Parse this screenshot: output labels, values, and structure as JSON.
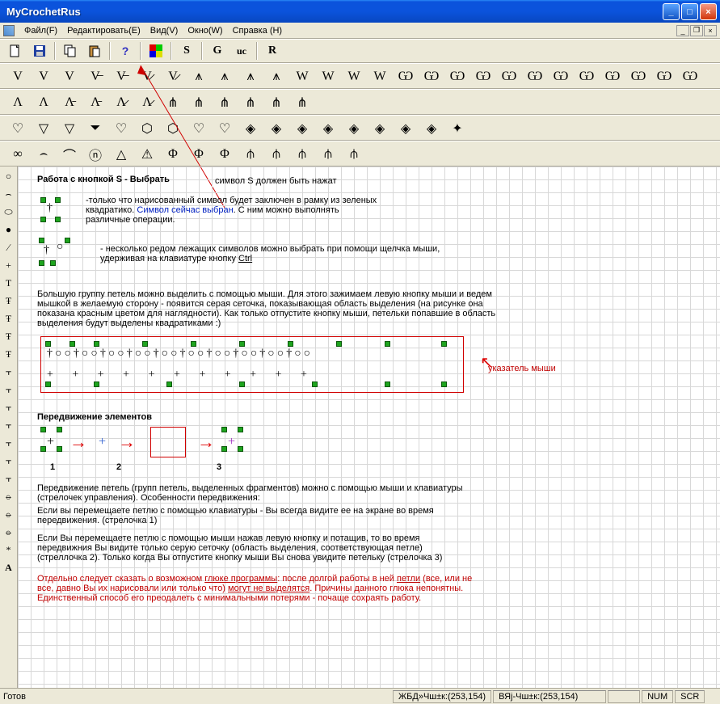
{
  "window": {
    "title": "MyCrochetRus"
  },
  "menu": {
    "file": "Файл(F)",
    "edit": "Редактировать(E)",
    "view": "Вид(V)",
    "window": "Окно(W)",
    "help": "Справка (H)"
  },
  "toolbar1": {
    "letters": [
      "S",
      "G",
      "uc",
      "R"
    ]
  },
  "doc": {
    "heading1": "Работа с кнопкой S - Выбрать",
    "callout1": "символ S должен быть нажат",
    "para1a": "-только что нарисованный символ будет заключен в рамку из зеленых квадратико. ",
    "para1b": "Символ сейчас выбран",
    "para1c": ". С ним можно выполнять различные операции.",
    "para2a": "- несколько редом лежащих символов можно выбрать при помощи щелчка мыши, удерживая на клавиатуре кнопку ",
    "para2b": "Ctrl",
    "para3": "Большую группу петель можно выделить с помощью мыши. Для этого зажимаем левую кнопку мыши и ведем мышкой в желаемую сторону - появится серая сеточка, показывающая область выделения (на рисунке она показана красным цветом для наглядности). Как только отпустите кнопку мыши, петельки попавшие в область выделения будут выделены квадратиками :)",
    "pointer_label": "указатель мыши",
    "heading2": "Передвижение элементов",
    "step1": "1",
    "step2": "2",
    "step3": "3",
    "para4": "Передвижение петель (групп петель, выделенных фрагментов) можно с помощью мыши и клавиатуры (стрелочек управления). Особенности передвижения:",
    "para5": "Если вы перемещаете петлю с помощью клавиатуры - Вы всегда видите ее на экране во время передвижения. (стрелочка 1)",
    "para6": "Если Вы перемещаете петлю с помощью мыши нажав левую кнопку и потащив, то во время передвижния Вы видите только серую сеточку (область выделения, соответствующая петле) (стреллочка 2). Только когда Вы отпустите кнопку мыши Вы снова увидите петельку (стрелочка 3)",
    "para7a": "Отдельно следует сказать о возможном ",
    "para7b": "глюке программы",
    "para7c": ": после долгой работы в ней ",
    "para7d": "петли",
    "para7e": " (все, или не все, давно Вы их нарисовали или только что) ",
    "para7f": "могут не выделятся",
    "para7g": ". Причины данного глюка непонятны. Единственный способ его преодалеть с минимальными потерями - почаще сохраять работу."
  },
  "status": {
    "ready": "Готов",
    "cell1": "ЖБД»Чш±к:(253,154)",
    "cell2": "ВЯј-Чш±к:(253,154)",
    "num": "NUM",
    "scr": "SCR"
  }
}
